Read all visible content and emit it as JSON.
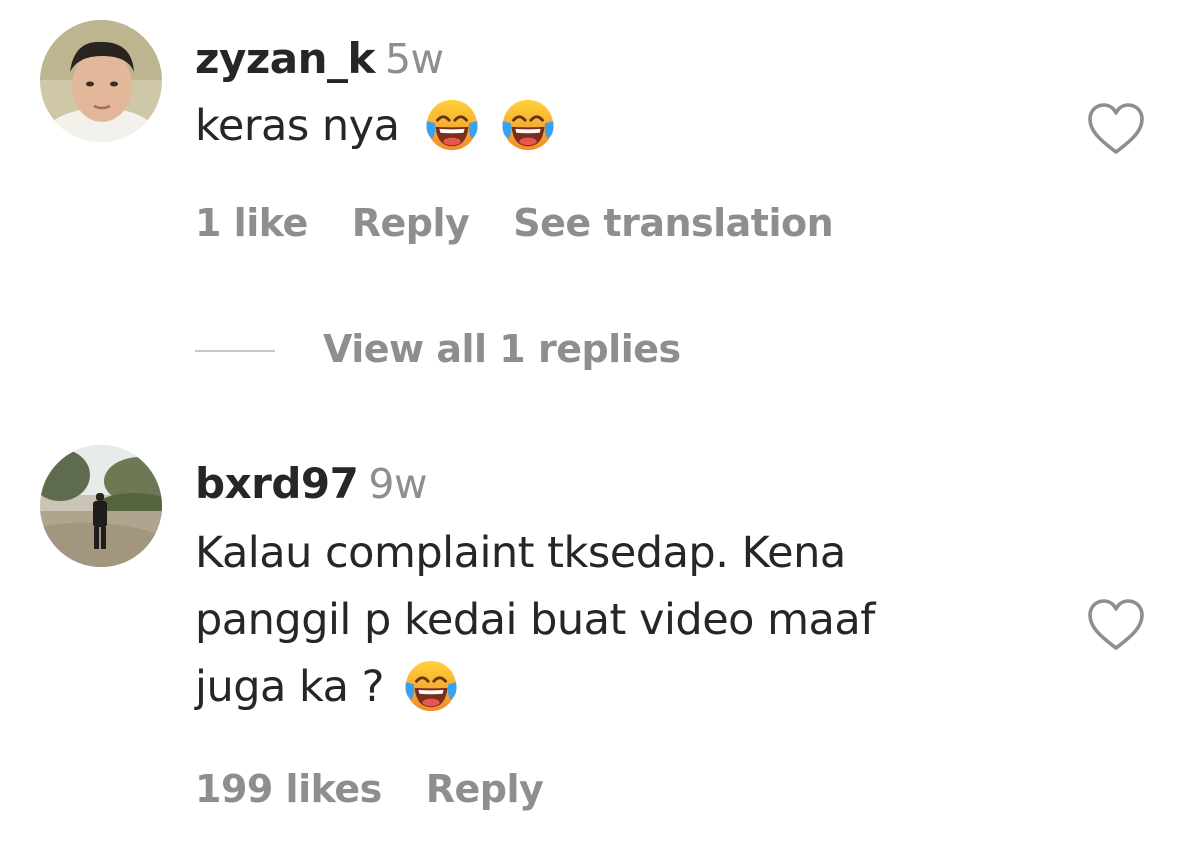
{
  "colors": {
    "primary_text": "#262626",
    "secondary_text": "#8e8e8e",
    "divider": "#c7c7c7"
  },
  "comments": [
    {
      "username": "zyzan_k",
      "time": "5w",
      "text_lines": [
        "keras nya"
      ],
      "emoji_count_line": [
        2
      ],
      "emoji": "face-with-tears-of-joy",
      "likes": "1 like",
      "reply_label": "Reply",
      "translate_label": "See translation",
      "like_icon": "heart-outline-icon"
    },
    {
      "username": "bxrd97",
      "time": "9w",
      "text_lines": [
        "Kalau complaint tksedap. Kena",
        "panggil p kedai buat video maaf",
        "juga ka ?"
      ],
      "emoji": "face-with-tears-of-joy",
      "likes": "199 likes",
      "reply_label": "Reply",
      "like_icon": "heart-outline-icon"
    }
  ],
  "view_replies_label": "View all 1 replies"
}
